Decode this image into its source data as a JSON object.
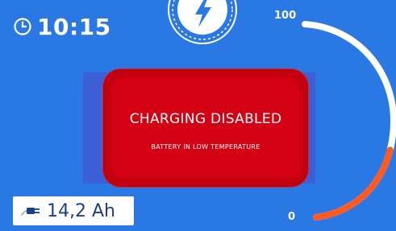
{
  "clock": {
    "time": "10:15",
    "icon": "clock-icon"
  },
  "charging_indicator": {
    "icon": "lightning-bolt-icon"
  },
  "battery_gauge": {
    "max_label": "100",
    "min_label": "0",
    "level_percent": 38,
    "colors": {
      "full_track": "#ffffff",
      "level": "#ff5a1f"
    }
  },
  "alert": {
    "title": "CHARGING DISABLED",
    "subtitle": "BATTERY IN LOW TEMPERATURE",
    "color": "#d40013"
  },
  "capacity": {
    "icon": "plug-icon",
    "value": "14,2 Ah"
  },
  "colors": {
    "background": "#2a78e4",
    "text": "#ffffff"
  }
}
